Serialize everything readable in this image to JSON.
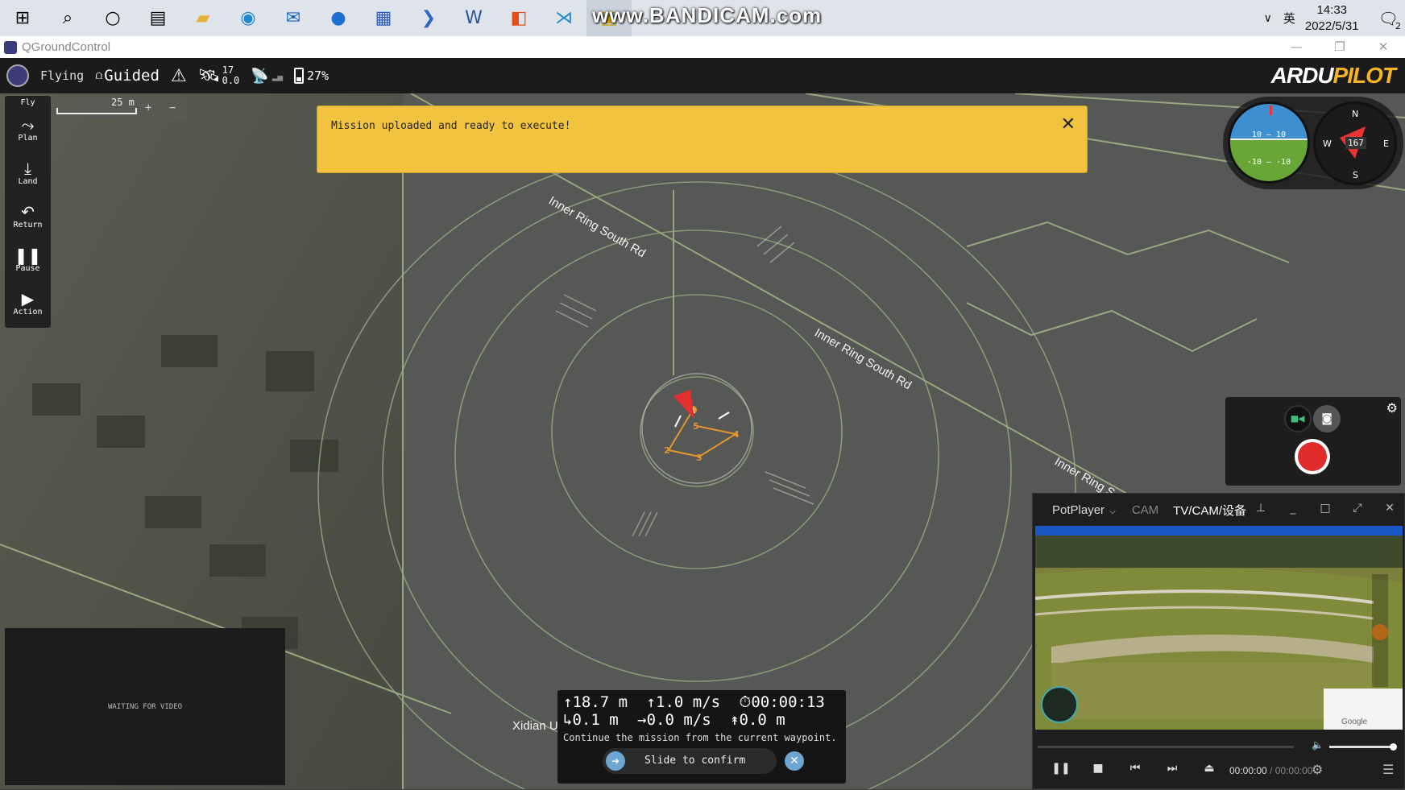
{
  "taskbar": {
    "watermark": "www.BANDICAM.com",
    "ime_label": "英",
    "time": "14:33",
    "date": "2022/5/31",
    "notification_count": "2"
  },
  "window": {
    "title": "QGroundControl"
  },
  "toolbar": {
    "flight_state": "Flying",
    "flight_mode": "Guided",
    "satellite_count": "17",
    "hdop": "0.0",
    "battery": "27%",
    "brand_left": "ARDU",
    "brand_right": "PILOT"
  },
  "toolstrip": {
    "items": [
      {
        "label": "Fly"
      },
      {
        "label": "Plan"
      },
      {
        "label": "Land"
      },
      {
        "label": "Return"
      },
      {
        "label": "Pause"
      },
      {
        "label": "Action"
      }
    ]
  },
  "map": {
    "scale_label": "25 m",
    "zoom_in": "+",
    "zoom_out": "−",
    "roads": [
      "Inner Ring South Rd",
      "Inner Ring South Rd",
      "Inner Ring So"
    ],
    "place_label": "Xidian U",
    "waypoints": [
      "1",
      "2",
      "3",
      "4",
      "5"
    ]
  },
  "banner": {
    "message": "Mission uploaded and ready to execute!"
  },
  "instruments": {
    "heading": "167",
    "pitch_marks": [
      "10",
      "10",
      "-10",
      "-10"
    ],
    "compass": {
      "n": "N",
      "s": "S",
      "e": "E",
      "w": "W"
    }
  },
  "video": {
    "waiting": "WAITING FOR VIDEO"
  },
  "telemetry": {
    "altitude": "18.7 m",
    "vertical_speed": "1.0 m/s",
    "flight_time": "00:00:13",
    "distance_to_wp": "0.1 m",
    "ground_speed": "0.0 m/s",
    "distance_home": "0.0 m",
    "guided_message": "Continue the mission from the current waypoint.",
    "slide_label": "Slide to confirm"
  },
  "potplayer": {
    "app_name": "PotPlayer",
    "tab_cam": "CAM",
    "tab_active": "TV/CAM/设备",
    "current_time": "00:00:00",
    "separator": "/",
    "duration": "00:00:00",
    "overlay_map_label": "Google"
  }
}
